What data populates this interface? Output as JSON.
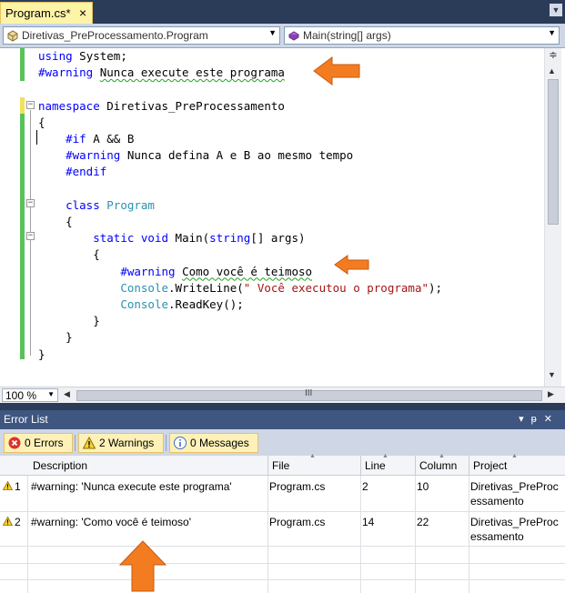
{
  "editor_tab": {
    "label": "Program.cs*",
    "close": "×",
    "dropdown": "▼"
  },
  "navigation": {
    "type_combo": "Diretivas_PreProcessamento.Program",
    "member_combo": "Main(string[] args)"
  },
  "code": {
    "lines": [
      [
        {
          "t": "using",
          "c": "kw"
        },
        {
          "t": " System;"
        }
      ],
      [
        {
          "t": "#warning",
          "c": "kw"
        },
        {
          "t": " "
        },
        {
          "t": "Nunca execute este programa",
          "c": "wavy"
        }
      ],
      [],
      [
        {
          "t": "namespace",
          "c": "kw"
        },
        {
          "t": " Diretivas_PreProcessamento"
        }
      ],
      [
        {
          "t": "{"
        }
      ],
      [
        {
          "t": "    "
        },
        {
          "t": "#if",
          "c": "kw"
        },
        {
          "t": " A && B"
        }
      ],
      [
        {
          "t": "    "
        },
        {
          "t": "#warning",
          "c": "kw"
        },
        {
          "t": " Nunca defina A e B ao mesmo tempo"
        }
      ],
      [
        {
          "t": "    "
        },
        {
          "t": "#endif",
          "c": "kw"
        }
      ],
      [],
      [
        {
          "t": "    "
        },
        {
          "t": "class",
          "c": "kw"
        },
        {
          "t": " "
        },
        {
          "t": "Program",
          "c": "ty"
        }
      ],
      [
        {
          "t": "    {"
        }
      ],
      [
        {
          "t": "        "
        },
        {
          "t": "static",
          "c": "kw"
        },
        {
          "t": " "
        },
        {
          "t": "void",
          "c": "kw"
        },
        {
          "t": " Main("
        },
        {
          "t": "string",
          "c": "kw"
        },
        {
          "t": "[] args)"
        }
      ],
      [
        {
          "t": "        {"
        }
      ],
      [
        {
          "t": "            "
        },
        {
          "t": "#warning",
          "c": "kw"
        },
        {
          "t": " "
        },
        {
          "t": "Como você é teimoso",
          "c": "wavy"
        }
      ],
      [
        {
          "t": "            "
        },
        {
          "t": "Console",
          "c": "ty"
        },
        {
          "t": ".WriteLine("
        },
        {
          "t": "\" Você executou o programa\"",
          "c": "st"
        },
        {
          "t": ");"
        }
      ],
      [
        {
          "t": "            "
        },
        {
          "t": "Console",
          "c": "ty"
        },
        {
          "t": ".ReadKey();"
        }
      ],
      [
        {
          "t": "        }"
        }
      ],
      [
        {
          "t": "    }"
        }
      ],
      [
        {
          "t": "}"
        }
      ]
    ]
  },
  "zoom": {
    "level": "100 %"
  },
  "hscroll_grip": "III",
  "error_list": {
    "title": "Error List",
    "title_buttons": "▾ ᛫ ✕",
    "filters": {
      "errors": "0 Errors",
      "warnings": "2 Warnings",
      "messages": "0 Messages"
    },
    "columns": [
      "Description",
      "File",
      "Line",
      "Column",
      "Project"
    ],
    "rows": [
      {
        "num": "1",
        "description": "#warning: 'Nunca execute este programa'",
        "file": "Program.cs",
        "line": "2",
        "column": "10",
        "project_l1": "Diretivas_PreProc",
        "project_l2": "essamento"
      },
      {
        "num": "2",
        "description": "#warning: 'Como você é teimoso'",
        "file": "Program.cs",
        "line": "14",
        "column": "22",
        "project_l1": "Diretivas_PreProc",
        "project_l2": "essamento"
      }
    ]
  },
  "colors": {
    "ide_frame": "#2b3c59",
    "toolwindow_title": "#3e5680",
    "tab_active": "#fef4a8",
    "keyword": "#0000ff",
    "type": "#2b91af",
    "string": "#a31515",
    "annotation_arrow": "#f47c20"
  }
}
